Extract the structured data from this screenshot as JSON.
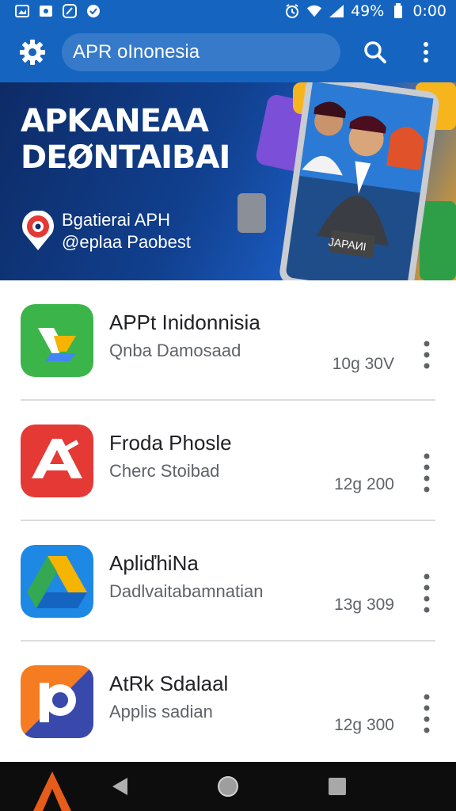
{
  "status_bar": {
    "battery_percent": "49%",
    "time": "0:00"
  },
  "app_bar": {
    "search_value": "APR oInonesia"
  },
  "banner": {
    "title_line1": "APKANEAA",
    "title_line2": "DEØNTAIBAI",
    "subtitle_line1": "Bgatierai APH",
    "subtitle_line2": "@eplaa Paobest",
    "sign_text": "JAPAИI"
  },
  "apps": [
    {
      "name": "APPt Inidonnisia",
      "subtitle": "Qnba Damosaad",
      "size": "10g 30V",
      "icon": "green-drive-icon"
    },
    {
      "name": "Froda Phosle",
      "subtitle": "Cherc Stoibad",
      "size": "12g 200",
      "icon": "red-a-icon"
    },
    {
      "name": "ApliďhiNa",
      "subtitle": "Dadlvaitabamnatian",
      "size": "13g 309",
      "icon": "drive-triangle-icon"
    },
    {
      "name": "AtRk Sdalaal",
      "subtitle": "Applis sadian",
      "size": "12g 300",
      "icon": "orange-p-icon"
    }
  ],
  "colors": {
    "primary": "#1565c0",
    "nav_bar": "#0d0d0d"
  }
}
